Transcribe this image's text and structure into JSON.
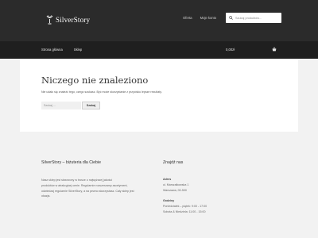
{
  "header": {
    "logo_text": "SilverStory",
    "links": [
      "Oferta",
      "Moje konto"
    ],
    "search_placeholder": "Szukaj produktów..."
  },
  "nav": {
    "items": [
      "Strona główna",
      "Sklep"
    ],
    "cart_total": "0,00zł"
  },
  "main": {
    "title": "Niczego nie znaleziono",
    "description": "Nie udało się znaleźć tego, czego szukasz. Być może skorzystanie z przycisku lepsze rezultaty.",
    "search_placeholder": "Szukaj …",
    "search_button": "Szukaj"
  },
  "footer": {
    "about_title": "SilverStory – biżuteria dla Ciebie",
    "about_text": [
      "Nasz sklep jest stworzony w trosce o najwyższej jakości",
      "produktów w atrakcyjnej cenie. Regularnie rozszerzamy asortyment,",
      "odwiedzaj regularnie SilverStory, a na pewno skorzystasz. Cały sklep jest",
      "okazja."
    ],
    "find_title": "Znajdź nas",
    "address_label": "Adres",
    "address_lines": [
      "ul. Marszałkowska 1",
      "Warszawa, 00-500"
    ],
    "hours_label": "Godziny",
    "hours_lines": [
      "Poniedziałek – piątek: 9:00 - 17:00",
      "Sobota & Niedziela: 11:00 - 15:00"
    ]
  },
  "colors": {
    "header_bg": "#2b2b2b",
    "nav_bg": "#1f1f1f",
    "page_bg": "#f2f2f2",
    "content_bg": "#ffffff"
  }
}
